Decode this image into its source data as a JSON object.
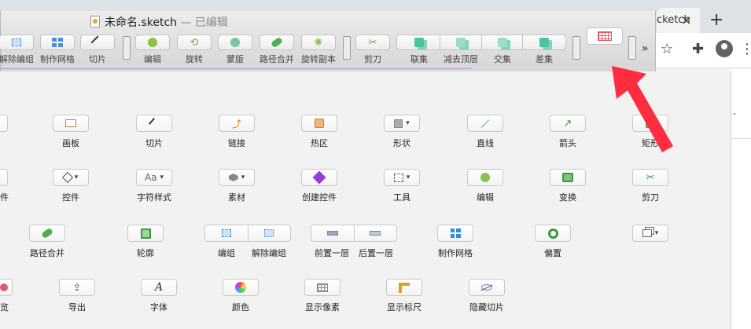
{
  "browser": {
    "tab_label": "cketch",
    "close": "×",
    "new_tab": "+",
    "content_snippet": "-"
  },
  "window": {
    "title": "未命名.sketch",
    "status": " — 已编辑"
  },
  "toolbar": {
    "items": [
      {
        "label": "解除编组",
        "icon": "ungroup-icon"
      },
      {
        "label": "制作网格",
        "icon": "make-grid-icon"
      },
      {
        "label": "切片",
        "icon": "slice-icon"
      },
      {
        "label": "编辑",
        "icon": "edit-icon"
      },
      {
        "label": "旋转",
        "icon": "rotate-icon"
      },
      {
        "label": "蒙版",
        "icon": "mask-icon"
      },
      {
        "label": "路径合并",
        "icon": "path-combine-icon"
      },
      {
        "label": "旋转副本",
        "icon": "rotate-copies-icon"
      },
      {
        "label": "剪刀",
        "icon": "scissors-icon"
      },
      {
        "label": "联集",
        "icon": "union-icon"
      },
      {
        "label": "减去顶层",
        "icon": "subtract-icon"
      },
      {
        "label": "交集",
        "icon": "intersect-icon"
      },
      {
        "label": "差集",
        "icon": "difference-icon"
      }
    ],
    "overflow": "»"
  },
  "palette": {
    "row1": [
      {
        "label": "画板"
      },
      {
        "label": "切片"
      },
      {
        "label": "链接"
      },
      {
        "label": "热区"
      },
      {
        "label": "形状"
      },
      {
        "label": "直线"
      },
      {
        "label": "箭头"
      },
      {
        "label": "矩形"
      }
    ],
    "row2": [
      {
        "label": "控件"
      },
      {
        "label": "字符样式"
      },
      {
        "label": "素材"
      },
      {
        "label": "创建控件"
      },
      {
        "label": "工具"
      },
      {
        "label": "编辑"
      },
      {
        "label": "变换"
      },
      {
        "label": "剪刀"
      }
    ],
    "row3": [
      {
        "label": "路径合并"
      },
      {
        "label": "轮廓"
      },
      {
        "label": "编组"
      },
      {
        "label": "解除编组"
      },
      {
        "label": "前置一层"
      },
      {
        "label": "后置一层"
      },
      {
        "label": "制作网格"
      },
      {
        "label": "偏置"
      }
    ],
    "row4": [
      {
        "label": "览"
      },
      {
        "label": "导出"
      },
      {
        "label": "字体"
      },
      {
        "label": "颜色"
      },
      {
        "label": "显示像素"
      },
      {
        "label": "显示标尺"
      },
      {
        "label": "隐藏切片"
      }
    ],
    "partial_row2_left": "件",
    "aa_text": "Aa",
    "font_glyph": "A"
  }
}
